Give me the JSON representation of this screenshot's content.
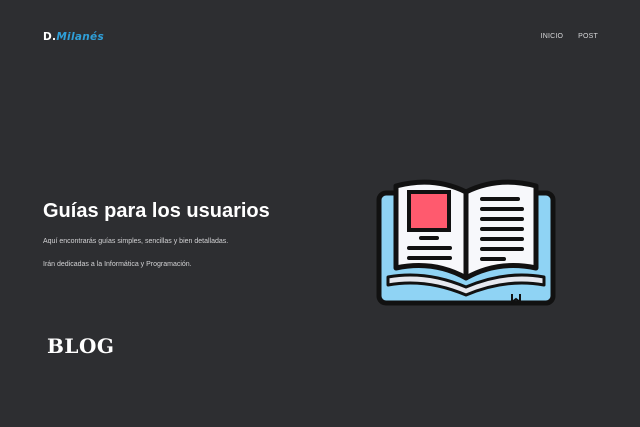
{
  "header": {
    "logo_main": "D.",
    "logo_accent": "Milanés",
    "nav": [
      "INICIO",
      "POST"
    ]
  },
  "hero": {
    "title": "Guías para los usuarios",
    "paragraph_1": "Aquí encontrarás guías simples, sencillas y bien detalladas.",
    "paragraph_2": "Irán dedicadas a la Informática y Programación.",
    "illustration": "open-book-icon"
  },
  "section": {
    "heading": "BLOG"
  },
  "colors": {
    "background": "#2d2e31",
    "accent": "#2f9fd8",
    "book_cover": "#8fd3f4",
    "book_bookmark": "#ff5a6e"
  }
}
